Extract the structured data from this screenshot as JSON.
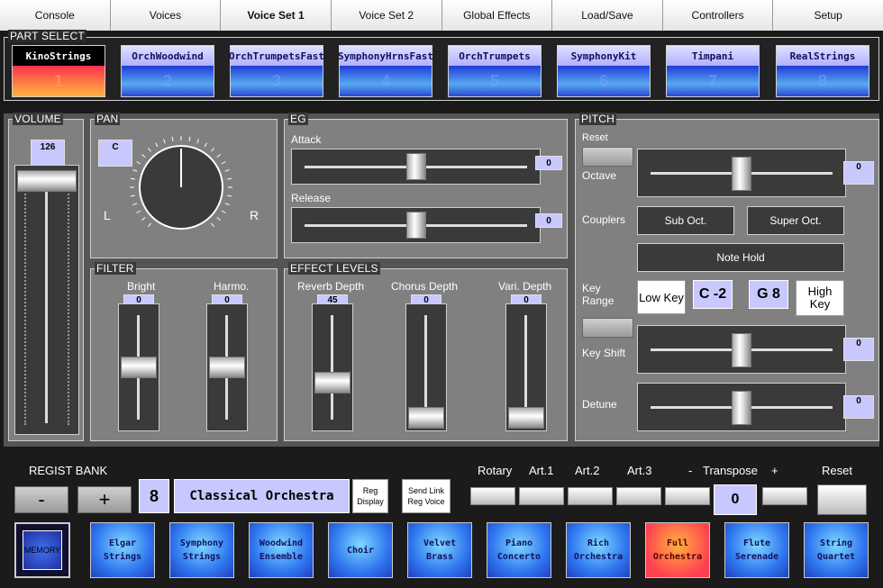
{
  "tabs": [
    "Console",
    "Voices",
    "Voice Set 1",
    "Voice Set 2",
    "Global Effects",
    "Load/Save",
    "Controllers",
    "Setup"
  ],
  "active_tab": 2,
  "part_select": {
    "title": "PART SELECT",
    "parts": [
      {
        "name": "KinoStrings",
        "num": "1"
      },
      {
        "name": "OrchWoodwind",
        "num": "2"
      },
      {
        "name": "OrchTrumpetsFast",
        "num": "3"
      },
      {
        "name": "SymphonyHrnsFast",
        "num": "4"
      },
      {
        "name": "OrchTrumpets",
        "num": "5"
      },
      {
        "name": "SymphonyKit",
        "num": "6"
      },
      {
        "name": "Timpani",
        "num": "7"
      },
      {
        "name": "RealStrings",
        "num": "8"
      }
    ],
    "selected_index": 0
  },
  "volume": {
    "title": "VOLUME",
    "value": "126",
    "level": 0.99
  },
  "pan": {
    "title": "PAN",
    "value": "C",
    "left": "L",
    "right": "R",
    "position": 0.5
  },
  "eg": {
    "title": "EG",
    "attack_label": "Attack",
    "attack_value": "0",
    "attack_level": 0.5,
    "release_label": "Release",
    "release_value": "0",
    "release_level": 0.5
  },
  "filter": {
    "title": "FILTER",
    "bright_label": "Bright",
    "bright_value": "0",
    "bright_level": 0.5,
    "harmo_label": "Harmo.",
    "harmo_value": "0",
    "harmo_level": 0.5
  },
  "effect_levels": {
    "title": "EFFECT LEVELS",
    "reverb_label": "Reverb Depth",
    "reverb_value": "45",
    "reverb_level": 0.35,
    "chorus_label": "Chorus Depth",
    "chorus_value": "0",
    "chorus_level": 0.0,
    "vari_label": "Vari. Depth",
    "vari_value": "0",
    "vari_level": 0.0
  },
  "pitch": {
    "title": "PITCH",
    "reset_label": "Reset",
    "octave_label": "Octave",
    "octave_value": "0",
    "octave_level": 0.5,
    "couplers_label": "Couplers",
    "sub_oct": "Sub Oct.",
    "super_oct": "Super Oct.",
    "note_hold": "Note Hold",
    "key_range_label": "Key\nRange",
    "low_key": "Low Key",
    "low_key_value": "C -2",
    "high_key_value": "G 8",
    "high_key": "High\nKey",
    "key_shift_label": "Key Shift",
    "key_shift_value": "0",
    "key_shift_level": 0.5,
    "detune_label": "Detune",
    "detune_value": "0",
    "detune_level": 0.5
  },
  "bottom": {
    "regist_bank_label": "REGIST BANK",
    "minus": "-",
    "plus": "+",
    "bank_number": "8",
    "bank_name": "Classical Orchestra",
    "reg_display": "Reg\nDisplay",
    "send_link": "Send Link\nReg Voice",
    "rotary": "Rotary",
    "art1": "Art.1",
    "art2": "Art.2",
    "art3": "Art.3",
    "transpose_minus": "-",
    "transpose_label": "Transpose",
    "transpose_plus": "+",
    "transpose_value": "0",
    "reset": "Reset",
    "memory": "MEMORY",
    "registrations": [
      "Elgar Strings",
      "Symphony Strings",
      "Woodwind Ensemble",
      "Choir",
      "Velvet Brass",
      "Piano Concerto",
      "Rich Orchestra",
      "Full Orchestra",
      "Flute Serenade",
      "String Quartet"
    ],
    "active_registration": 7
  }
}
